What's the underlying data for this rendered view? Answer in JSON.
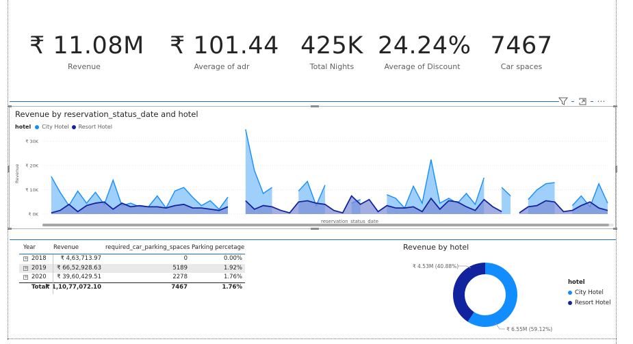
{
  "kpis": [
    {
      "value": "₹ 11.08M",
      "label": "Revenue"
    },
    {
      "value": "₹ 101.44",
      "label": "Average of adr"
    },
    {
      "value": "425K",
      "label": "Total Nights"
    },
    {
      "value": "24.24%",
      "label": "Average of Discount"
    },
    {
      "value": "7467",
      "label": "Car spaces"
    }
  ],
  "visual_header": {
    "icons": [
      "filter-icon",
      "focus-mode-icon",
      "more-options-icon"
    ]
  },
  "colors": {
    "city_hotel": "#118dff",
    "resort_hotel": "#12239e",
    "city_area_fill": "#8ec8fb",
    "resort_area_fill": "#7b8bd6",
    "accent_line": "#1f6fc0"
  },
  "chart_data": [
    {
      "type": "area",
      "title": "Revenue by reservation_status_date and hotel",
      "legend_title": "hotel",
      "legend_position": "top-left",
      "xlabel": "reservation_status_date",
      "ylabel": "Revenue",
      "y_ticks": [
        "₹ 0K",
        "₹ 10K",
        "₹ 20K",
        "₹ 30K"
      ],
      "ylim": [
        0,
        35000
      ],
      "grid": true,
      "series": [
        {
          "name": "City Hotel",
          "values": [
            null,
            15500,
            9000,
            3500,
            9500,
            4500,
            9000,
            4000,
            14000,
            3500,
            4500,
            3000,
            3000,
            7500,
            2500,
            9500,
            11000,
            7000,
            3500,
            5500,
            2000,
            7000,
            null,
            35000,
            18000,
            8500,
            11000,
            null,
            null,
            9500,
            13500,
            3500,
            12000,
            null,
            null,
            4500,
            6000,
            null,
            null,
            8000,
            6500,
            2500,
            11500,
            4500,
            22500,
            4500,
            6500,
            4500,
            8500,
            4000,
            15000,
            null,
            11000,
            7500,
            null,
            6000,
            10000,
            12500,
            13000,
            null,
            3500,
            7500,
            3000,
            12500,
            4500
          ]
        },
        {
          "name": "Resort Hotel",
          "values": [
            null,
            500,
            1500,
            4000,
            1000,
            3500,
            4500,
            5000,
            2000,
            4500,
            3000,
            3500,
            3000,
            3000,
            2500,
            3500,
            4000,
            2500,
            2500,
            2000,
            1500,
            3000,
            null,
            5500,
            2000,
            3500,
            3000,
            1500,
            500,
            5000,
            5500,
            4500,
            4000,
            1500,
            500,
            7500,
            4000,
            6000,
            1000,
            3500,
            2500,
            2500,
            3000,
            1000,
            6500,
            2000,
            5500,
            5000,
            3000,
            1500,
            6000,
            3000,
            1000,
            null,
            500,
            3000,
            3500,
            5500,
            5000,
            1000,
            1500,
            3500,
            5000,
            2500,
            1500
          ]
        }
      ]
    },
    {
      "type": "table",
      "columns": [
        "Year",
        "Revenue",
        "required_car_parking_spaces",
        "Parking percetage"
      ],
      "rows": [
        [
          "2018",
          "₹ 4,63,713.97",
          "0",
          "0.00%"
        ],
        [
          "2019",
          "₹ 66,52,928.63",
          "5189",
          "1.92%"
        ],
        [
          "2020",
          "₹ 39,60,429.51",
          "2278",
          "1.76%"
        ]
      ],
      "total": [
        "Total",
        "₹ 1,10,77,072.10",
        "7467",
        "1.76%"
      ]
    },
    {
      "type": "pie",
      "title": "Revenue by hotel",
      "legend_title": "hotel",
      "legend_position": "right",
      "categories": [
        "City Hotel",
        "Resort Hotel"
      ],
      "values": [
        59.12,
        40.88
      ],
      "labels": [
        "₹ 6.55M (59.12%)",
        "₹ 4.53M (40.88%)"
      ]
    }
  ]
}
